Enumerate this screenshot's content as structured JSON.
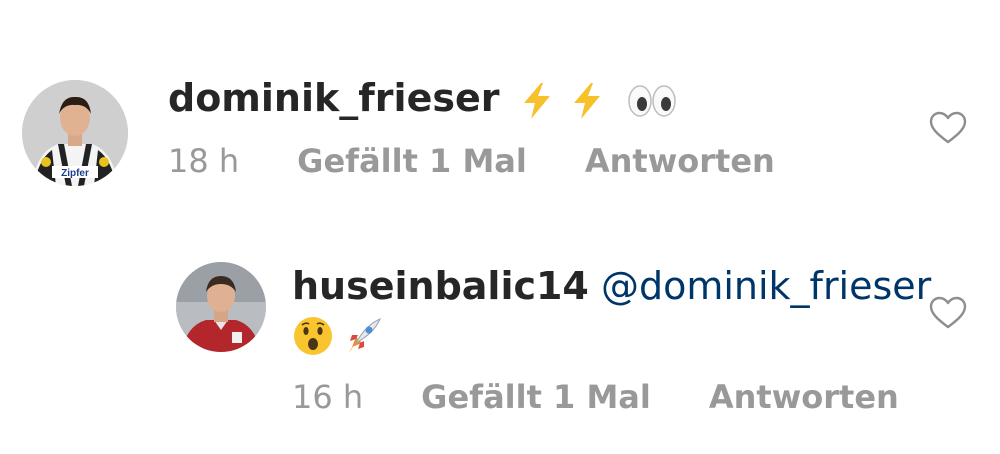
{
  "comments": [
    {
      "username": "dominik_frieser",
      "text_emojis": [
        "high-voltage",
        "high-voltage",
        "eyes"
      ],
      "time": "18 h",
      "likes": "Gefällt 1 Mal",
      "reply": "Antworten",
      "avatar_jersey_text": "Zipfer"
    },
    {
      "username": "huseinbalic14",
      "mention": "@dominik_frieser",
      "text_emojis": [
        "hushed-face",
        "rocket"
      ],
      "time": "16 h",
      "likes": "Gefällt 1 Mal",
      "reply": "Antworten"
    }
  ],
  "colors": {
    "username": "#262626",
    "mention": "#003569",
    "meta": "#999999",
    "heart_outline": "#8e8e8e"
  }
}
